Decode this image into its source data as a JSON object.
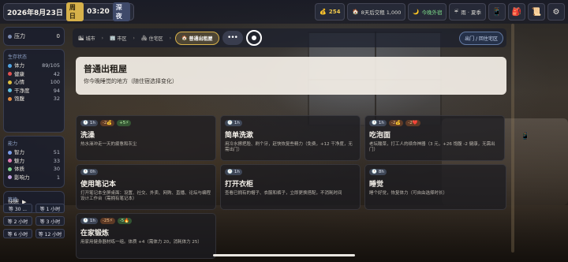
{
  "topbar": {
    "date": "2026年8月23日",
    "weekday": "周日",
    "time": "03:20",
    "period": "深夜",
    "money": "254",
    "quest": "8天后交租 1,000",
    "outfit": "今晚外宿",
    "weather": "雨 · 夏季"
  },
  "left": {
    "pressure_label": "压力",
    "pressure_value": "0",
    "status_title": "生存状态",
    "status": [
      {
        "name": "体力",
        "value": "89/105",
        "color": "#4fa3e0"
      },
      {
        "name": "健康",
        "value": "42",
        "color": "#e05050"
      },
      {
        "name": "心情",
        "value": "100",
        "color": "#e0c040"
      },
      {
        "name": "干净度",
        "value": "94",
        "color": "#60c0e0"
      },
      {
        "name": "饱腹",
        "value": "32",
        "color": "#e08a40"
      }
    ],
    "ability_title": "能力",
    "abilities": [
      {
        "name": "智力",
        "value": "51",
        "color": "#7a9de8"
      },
      {
        "name": "魅力",
        "value": "33",
        "color": "#e07ab0"
      },
      {
        "name": "体质",
        "value": "30",
        "color": "#7ad08a"
      },
      {
        "name": "影响力",
        "value": "1",
        "color": "#c0a0e0"
      }
    ],
    "skip_label": "快眠",
    "wait_title": "等待",
    "wait_options": [
      "等 30 ...",
      "等 1 小时",
      "等 2 小时",
      "等 3 小时",
      "等 6 小时",
      "等 12 小时"
    ]
  },
  "nav": {
    "crumbs": [
      "城市",
      "市区",
      "住宅区",
      "普通出租屋"
    ],
    "exit_label": "出门 / 回住宅区"
  },
  "header": {
    "title": "普通出租屋",
    "subtitle": "你今晚睡觉的地方（随住宿选择变化）"
  },
  "actions": [
    {
      "tags": [
        {
          "t": "1h",
          "k": "time"
        },
        {
          "t": "-2💰",
          "k": "cost"
        },
        {
          "t": "+5⚡",
          "k": "gain"
        }
      ],
      "title": "洗澡",
      "desc": "热水澡冲走一天的疲惫和灰尘"
    },
    {
      "tags": [
        {
          "t": "1h",
          "k": "time"
        }
      ],
      "title": "简单洗漱",
      "desc": "用冷水擦把脸、刷个牙，赶快恢复些精力（免费，+12 干净度，无需出门）"
    },
    {
      "tags": [
        {
          "t": "1h",
          "k": "time"
        },
        {
          "t": "-2💰",
          "k": "cost"
        },
        {
          "t": "-2❤️",
          "k": "cost"
        }
      ],
      "title": "吃泡面",
      "desc": "老坛酸菜，打工人的续命神器（3 元，+26 饱腹 -2 健康，无需出门）"
    },
    {
      "tags": [
        {
          "t": "0h",
          "k": "time"
        }
      ],
      "title": "使用笔记本",
      "desc": "打开笔记本全屏桌面：设置、社交、外卖、网购、直播、论坛与编程设计工作台（需拥有笔记本）"
    },
    {
      "tags": [
        {
          "t": "1h",
          "k": "time"
        }
      ],
      "title": "打开衣柜",
      "desc": "查看已拥有的帽子、衣服和裤子，立即更换搭配，不消耗时间"
    },
    {
      "tags": [
        {
          "t": "8h",
          "k": "time"
        }
      ],
      "title": "睡觉",
      "desc": "睡个好觉，恢复体力（可自由选择时长）"
    },
    {
      "tags": [
        {
          "t": "1h",
          "k": "time"
        },
        {
          "t": "-25⚡",
          "k": "cost"
        },
        {
          "t": "-5🔥",
          "k": "gain"
        }
      ],
      "title": "在家锻炼",
      "desc": "用家用健身器材练一组。体质 +4（需体力 20，消耗体力 25）"
    }
  ]
}
